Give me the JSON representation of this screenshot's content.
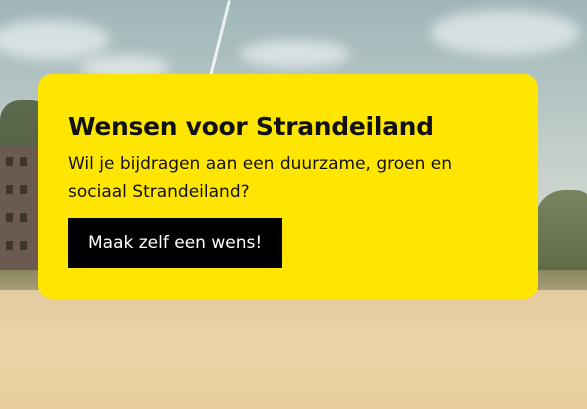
{
  "card": {
    "title": "Wensen voor Strandeiland",
    "text": "Wil je bijdragen aan een duurzame, groen en sociaal Strandeiland?",
    "button_label": "Maak zelf een wens!"
  },
  "colors": {
    "card_background": "#ffe600",
    "button_background": "#000000",
    "button_text": "#ffffff",
    "text": "#111111"
  }
}
